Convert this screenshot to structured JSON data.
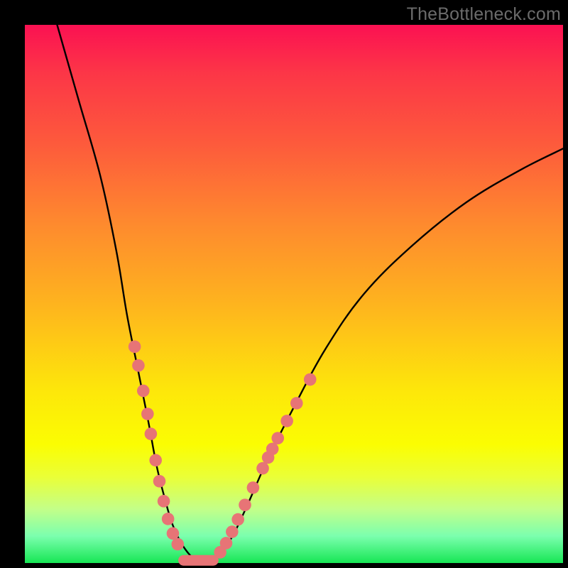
{
  "watermark": "TheBottleneck.com",
  "chart_data": {
    "type": "line",
    "title": "",
    "xlabel": "",
    "ylabel": "",
    "xlim": [
      0,
      100
    ],
    "ylim": [
      0,
      100
    ],
    "grid": false,
    "legend": false,
    "series": [
      {
        "name": "bottleneck-curve",
        "x": [
          6,
          10,
          14,
          17,
          19,
          21,
          23,
          24.5,
          26,
          27.5,
          29.5,
          32,
          35,
          38,
          41,
          45,
          50,
          56,
          63,
          72,
          82,
          92,
          100
        ],
        "values": [
          100,
          86,
          72,
          58,
          46,
          36,
          26,
          18,
          12,
          7,
          3,
          0.5,
          0.5,
          4,
          10,
          19,
          29,
          40,
          50,
          59,
          67,
          73,
          77
        ]
      }
    ],
    "valley_segment": {
      "x0": 29.5,
      "x1": 35,
      "y": 0.5
    },
    "marker_points": [
      {
        "x": 20.4,
        "y": 40.2
      },
      {
        "x": 21.1,
        "y": 36.7
      },
      {
        "x": 22.0,
        "y": 32.0
      },
      {
        "x": 22.8,
        "y": 27.7
      },
      {
        "x": 23.4,
        "y": 24.0
      },
      {
        "x": 24.3,
        "y": 19.1
      },
      {
        "x": 25.0,
        "y": 15.2
      },
      {
        "x": 25.8,
        "y": 11.5
      },
      {
        "x": 26.6,
        "y": 8.2
      },
      {
        "x": 27.5,
        "y": 5.5
      },
      {
        "x": 28.4,
        "y": 3.5
      },
      {
        "x": 36.3,
        "y": 2.0
      },
      {
        "x": 37.4,
        "y": 3.7
      },
      {
        "x": 38.5,
        "y": 5.8
      },
      {
        "x": 39.6,
        "y": 8.1
      },
      {
        "x": 40.9,
        "y": 10.8
      },
      {
        "x": 42.4,
        "y": 14.0
      },
      {
        "x": 44.2,
        "y": 17.6
      },
      {
        "x": 45.2,
        "y": 19.6
      },
      {
        "x": 46.0,
        "y": 21.2
      },
      {
        "x": 47.0,
        "y": 23.2
      },
      {
        "x": 48.7,
        "y": 26.4
      },
      {
        "x": 50.5,
        "y": 29.7
      },
      {
        "x": 53.0,
        "y": 34.1
      }
    ]
  }
}
